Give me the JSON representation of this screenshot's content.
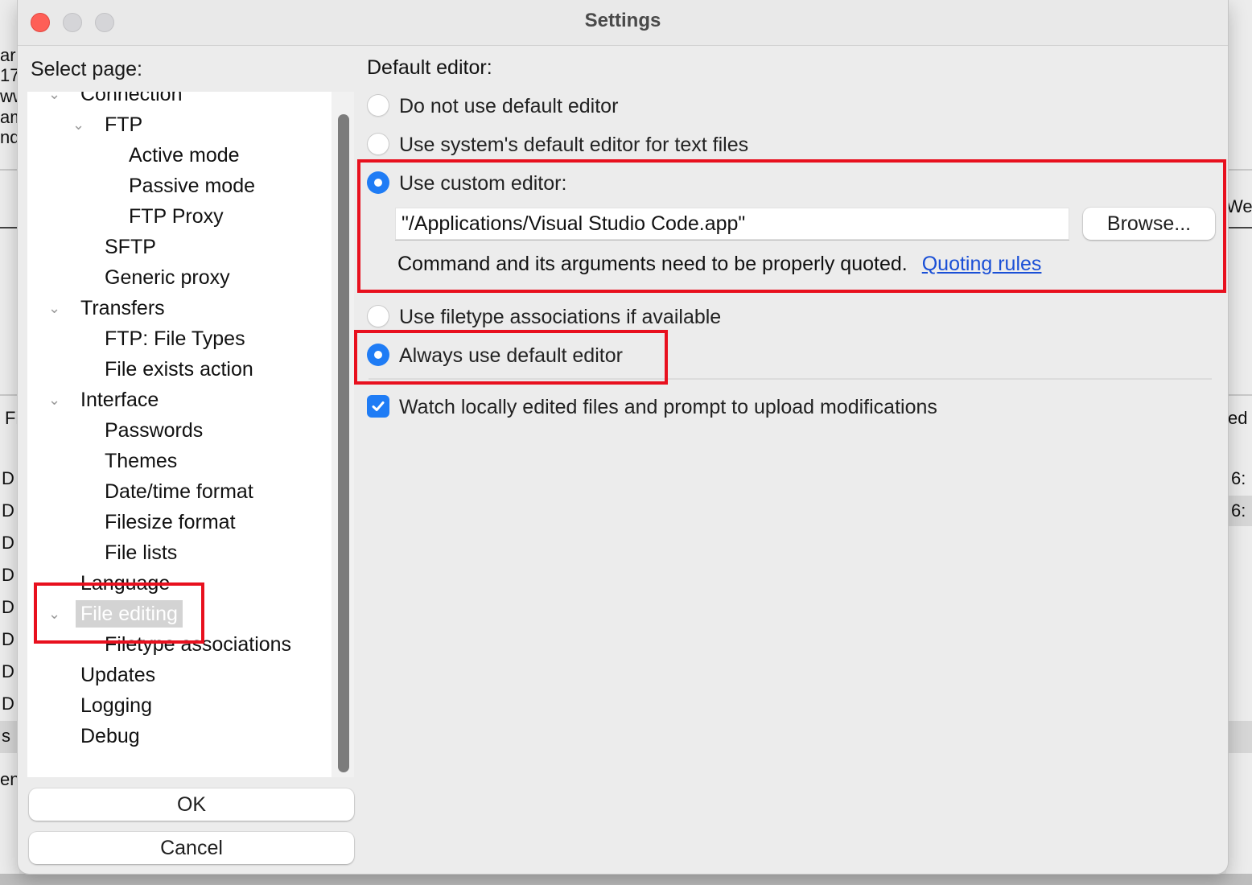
{
  "background": {
    "left_fragments": [
      "ar",
      "17",
      "ww",
      "am",
      "nd",
      "Fi",
      "D",
      "D",
      "D",
      "D",
      "D",
      "D",
      "D",
      "D",
      "s",
      "en"
    ],
    "right_fragments": [
      "We",
      "ed",
      "6:",
      "6:"
    ]
  },
  "window": {
    "title": "Settings",
    "controls": {
      "close": "close-window",
      "minimize": "minimize-window",
      "zoom": "zoom-window"
    }
  },
  "left_panel": {
    "select_label": "Select page:",
    "tree": [
      {
        "label": "Connection",
        "level": 0,
        "expanded": true
      },
      {
        "label": "FTP",
        "level": 1,
        "expanded": true
      },
      {
        "label": "Active mode",
        "level": 2
      },
      {
        "label": "Passive mode",
        "level": 2
      },
      {
        "label": "FTP Proxy",
        "level": 2
      },
      {
        "label": "SFTP",
        "level": 1
      },
      {
        "label": "Generic proxy",
        "level": 1
      },
      {
        "label": "Transfers",
        "level": 0,
        "expanded": true
      },
      {
        "label": "FTP: File Types",
        "level": 1
      },
      {
        "label": "File exists action",
        "level": 1
      },
      {
        "label": "Interface",
        "level": 0,
        "expanded": true
      },
      {
        "label": "Passwords",
        "level": 1
      },
      {
        "label": "Themes",
        "level": 1
      },
      {
        "label": "Date/time format",
        "level": 1
      },
      {
        "label": "Filesize format",
        "level": 1
      },
      {
        "label": "File lists",
        "level": 1
      },
      {
        "label": "Language",
        "level": 0
      },
      {
        "label": "File editing",
        "level": 0,
        "expanded": true,
        "selected": true
      },
      {
        "label": "Filetype associations",
        "level": 1
      },
      {
        "label": "Updates",
        "level": 0
      },
      {
        "label": "Logging",
        "level": 0
      },
      {
        "label": "Debug",
        "level": 0
      }
    ],
    "ok_label": "OK",
    "cancel_label": "Cancel"
  },
  "right_panel": {
    "section_label": "Default editor:",
    "default_editor_options": [
      {
        "label": "Do not use default editor",
        "selected": false
      },
      {
        "label": "Use system's default editor for text files",
        "selected": false
      },
      {
        "label": "Use custom editor:",
        "selected": true
      }
    ],
    "custom_editor_value": "\"/Applications/Visual Studio Code.app\"",
    "browse_label": "Browse...",
    "quoting_hint": "Command and its arguments need to be properly quoted.",
    "quoting_link": "Quoting rules",
    "association_options": [
      {
        "label": "Use filetype associations if available",
        "selected": false
      },
      {
        "label": "Always use default editor",
        "selected": true
      }
    ],
    "watch_checkbox": {
      "label": "Watch locally edited files and prompt to upload modifications",
      "checked": true
    }
  },
  "colors": {
    "accent": "#1f7cf5",
    "annotation": "#e8101e",
    "link": "#1a4fd6",
    "close_button": "#fe5f57"
  }
}
